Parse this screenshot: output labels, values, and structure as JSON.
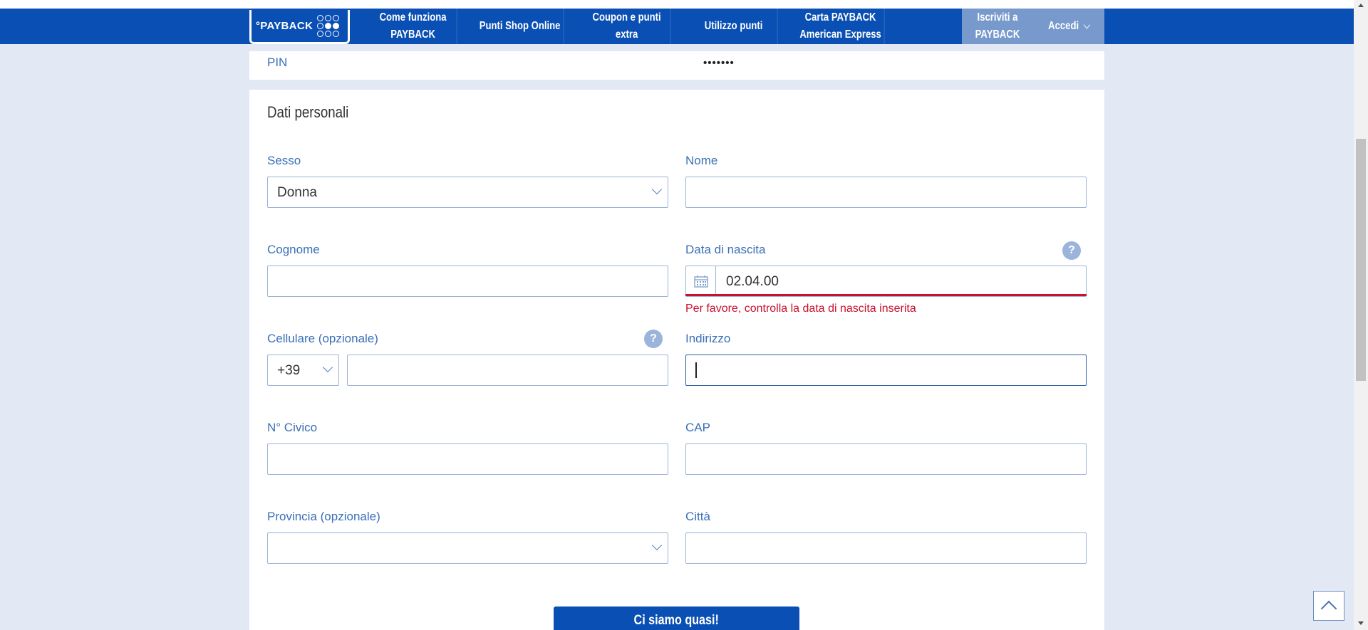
{
  "brand": {
    "logo_text": "°PAYBACK"
  },
  "nav": {
    "items": [
      {
        "line1": "Come funziona",
        "line2": "PAYBACK"
      },
      {
        "line1": "Punti Shop Online",
        "line2": ""
      },
      {
        "line1": "Coupon e punti extra",
        "line2": ""
      },
      {
        "line1": "Utilizzo punti",
        "line2": ""
      },
      {
        "line1": "Carta PAYBACK",
        "line2": "American Express"
      }
    ],
    "signup_line1": "Iscriviti a",
    "signup_line2": "PAYBACK",
    "login": "Accedi"
  },
  "pin": {
    "label": "PIN",
    "value": "•••••••"
  },
  "section_title": "Dati personali",
  "form": {
    "sesso": {
      "label": "Sesso",
      "value": "Donna"
    },
    "nome": {
      "label": "Nome",
      "value": ""
    },
    "cognome": {
      "label": "Cognome",
      "value": ""
    },
    "data_nascita": {
      "label": "Data di nascita",
      "value": "02.04.00",
      "error": "Per favore, controlla la data di nascita inserita",
      "help": "?"
    },
    "cellulare": {
      "label": "Cellulare (opzionale)",
      "prefix": "+39",
      "value": "",
      "help": "?"
    },
    "indirizzo": {
      "label": "Indirizzo",
      "value": ""
    },
    "civico": {
      "label": "N° Civico",
      "value": ""
    },
    "cap": {
      "label": "CAP",
      "value": ""
    },
    "provincia": {
      "label": "Provincia (opzionale)",
      "value": ""
    },
    "citta": {
      "label": "Città",
      "value": ""
    }
  },
  "submit_label": "Ci siamo quasi!",
  "colors": {
    "brand_blue": "#0a4fb3",
    "error_red": "#c8102e",
    "label_blue": "#3a6fb7"
  }
}
